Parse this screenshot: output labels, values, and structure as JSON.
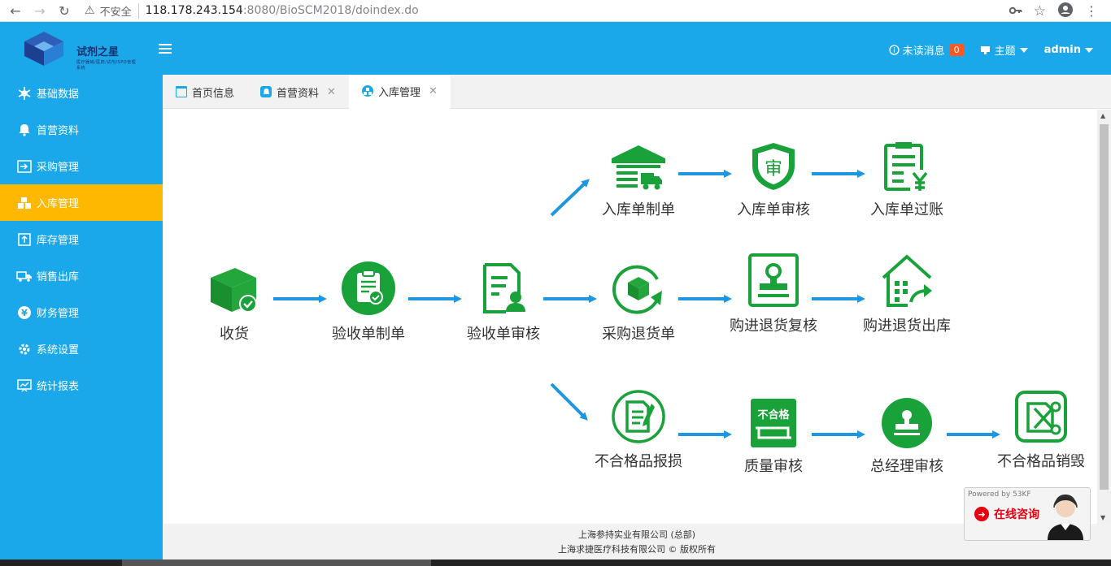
{
  "browser": {
    "security_label": "不安全",
    "url_host": "118.178.243.154",
    "url_path": ":8080/BioSCM2018/doindex.do"
  },
  "header": {
    "logo_title": "试剂之星",
    "logo_subtitle": "医疗器械/医药/试剂/SPD管理系统",
    "unread_label": "未读消息",
    "unread_count": "0",
    "theme_label": "主题",
    "user_label": "admin"
  },
  "sidebar": {
    "items": [
      {
        "label": "基础数据",
        "icon": "snowflake-icon"
      },
      {
        "label": "首营资料",
        "icon": "bell-icon"
      },
      {
        "label": "采购管理",
        "icon": "login-icon"
      },
      {
        "label": "入库管理",
        "icon": "boxes-icon"
      },
      {
        "label": "库存管理",
        "icon": "upload-icon"
      },
      {
        "label": "销售出库",
        "icon": "truck-icon"
      },
      {
        "label": "财务管理",
        "icon": "yen-icon"
      },
      {
        "label": "系统设置",
        "icon": "gear-icon"
      },
      {
        "label": "统计报表",
        "icon": "board-icon"
      }
    ]
  },
  "tabs": [
    {
      "label": "首页信息",
      "closable": false
    },
    {
      "label": "首营资料",
      "closable": true
    },
    {
      "label": "入库管理",
      "closable": true
    }
  ],
  "flow": {
    "receive": "收货",
    "inspect_create": "验收单制单",
    "inspect_review": "验收单审核",
    "purchase_return": "采购退货单",
    "return_recheck": "购进退货复核",
    "return_out": "购进退货出库",
    "stockin_create": "入库单制单",
    "stockin_review": "入库单审核",
    "stockin_post": "入库单过账",
    "defect_report": "不合格品报损",
    "quality_review": "质量审核",
    "gm_review": "总经理审核",
    "defect_destroy": "不合格品销毁",
    "shield_char": "审",
    "unqualified_char": "不合格"
  },
  "footer": {
    "line1": "上海参持实业有限公司 (总部)",
    "line2": "上海求捷医疗科技有限公司 © 版权所有"
  },
  "chat": {
    "powered": "Powered by 53KF",
    "label": "在线咨询"
  },
  "colors": {
    "primary": "#1ba8eb",
    "active": "#ffb800",
    "flow_green": "#1aa23a",
    "arrow_blue": "#1f97e0"
  }
}
